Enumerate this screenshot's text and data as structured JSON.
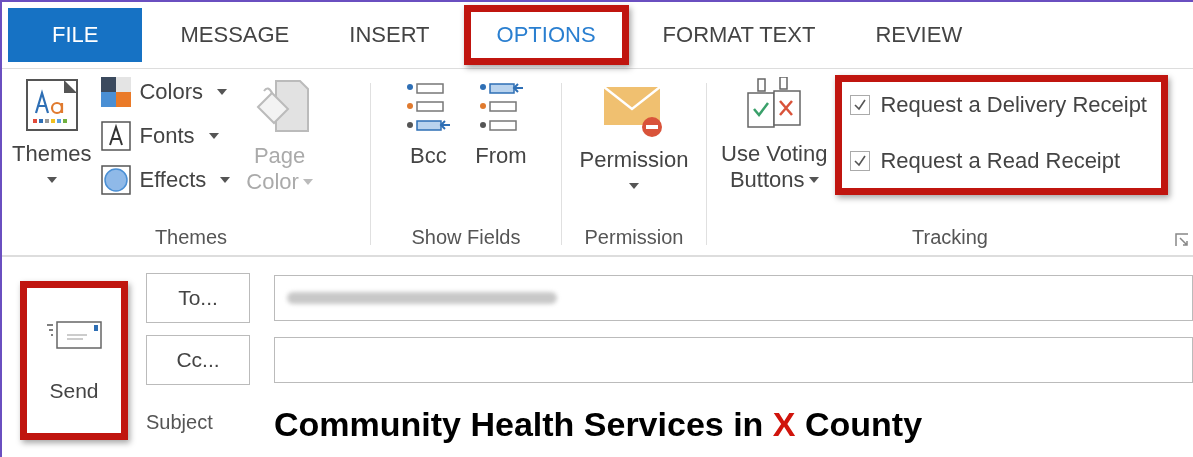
{
  "tabs": [
    {
      "label": "FILE",
      "kind": "file",
      "selected": false,
      "highlighted": false
    },
    {
      "label": "MESSAGE",
      "kind": "tab",
      "selected": false,
      "highlighted": false
    },
    {
      "label": "INSERT",
      "kind": "tab",
      "selected": false,
      "highlighted": false
    },
    {
      "label": "OPTIONS",
      "kind": "tab",
      "selected": true,
      "highlighted": true
    },
    {
      "label": "FORMAT TEXT",
      "kind": "tab",
      "selected": false,
      "highlighted": false
    },
    {
      "label": "REVIEW",
      "kind": "tab",
      "selected": false,
      "highlighted": false
    }
  ],
  "ribbon": {
    "themes": {
      "label": "Themes",
      "themes_button": "Themes",
      "colors": "Colors",
      "fonts": "Fonts",
      "effects": "Effects",
      "page_color": {
        "lines": [
          "Page",
          "Color"
        ],
        "disabled": true
      }
    },
    "show_fields": {
      "label": "Show Fields",
      "bcc": "Bcc",
      "from": "From"
    },
    "permission": {
      "label": "Permission",
      "button": "Permission"
    },
    "tracking": {
      "label": "Tracking",
      "voting": {
        "lines": [
          "Use Voting",
          "Buttons"
        ]
      },
      "highlighted": true,
      "options": [
        {
          "label": "Request a Delivery Receipt",
          "checked": true
        },
        {
          "label": "Request a Read Receipt",
          "checked": true
        }
      ]
    }
  },
  "compose": {
    "send": {
      "label": "Send",
      "highlighted": true
    },
    "to_button": "To...",
    "cc_button": "Cc...",
    "subject_label": "Subject",
    "subject": [
      {
        "text": "Community Health Services in ",
        "emphasis": false
      },
      {
        "text": "X",
        "emphasis": true
      },
      {
        "text": " County",
        "emphasis": false
      }
    ]
  }
}
